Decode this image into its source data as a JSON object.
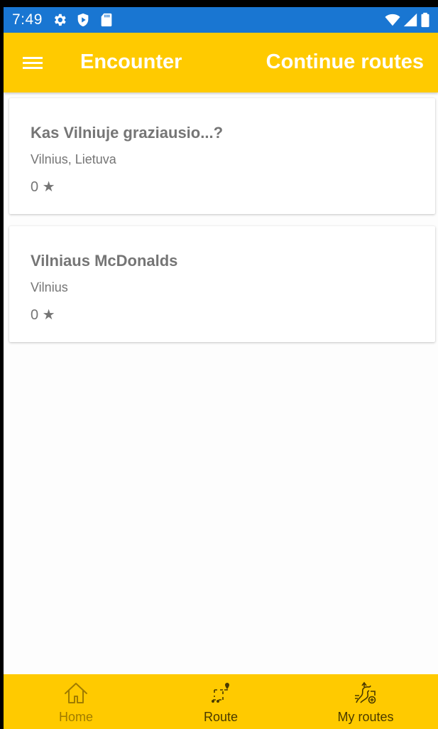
{
  "status_bar": {
    "time": "7:49",
    "icons": [
      "gear-icon",
      "play-shield-icon",
      "sd-card-icon",
      "wifi-icon",
      "signal-icon",
      "battery-icon"
    ]
  },
  "app_bar": {
    "menu_icon": "hamburger-menu-icon",
    "title": "Encounter",
    "action_label": "Continue routes"
  },
  "routes": [
    {
      "title": "Kas Vilniuje graziausio...?",
      "location": "Vilnius, Lietuva",
      "rating": "0 ★"
    },
    {
      "title": "Vilniaus McDonalds",
      "location": "Vilnius",
      "rating": "0 ★"
    }
  ],
  "bottom_nav": {
    "items": [
      {
        "label": "Home",
        "icon": "home-icon",
        "active": false
      },
      {
        "label": "Route",
        "icon": "route-icon",
        "active": true
      },
      {
        "label": "My routes",
        "icon": "my-routes-icon",
        "active": true
      }
    ]
  },
  "colors": {
    "status_bar": "#1976d2",
    "accent": "#ffca00",
    "card_text": "#757575",
    "nav_inactive": "#a07c00",
    "nav_active": "#4a3a00"
  }
}
